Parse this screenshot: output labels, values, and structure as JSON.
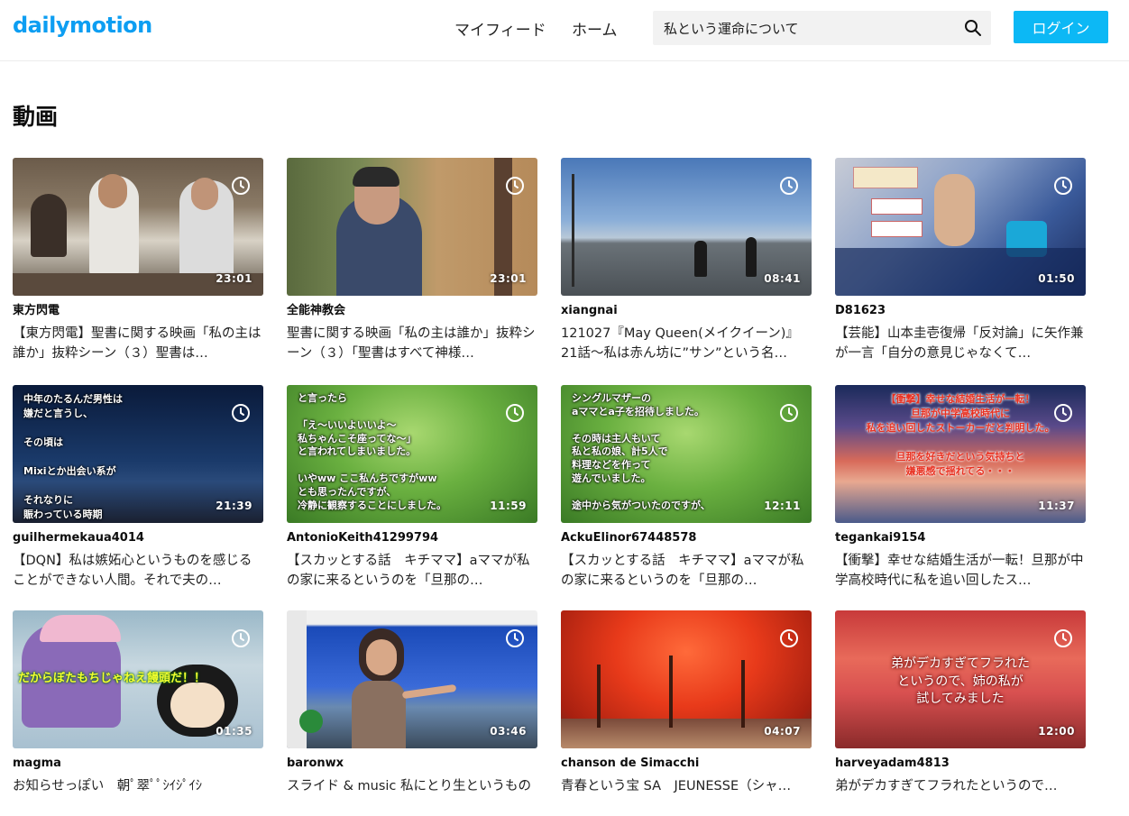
{
  "header": {
    "logo": "dailymotion",
    "nav_feed": "マイフィード",
    "nav_home": "ホーム",
    "search_value": "私という運命について",
    "login_label": "ログイン"
  },
  "section_title": "動画",
  "videos": [
    {
      "channel": "東方閃電",
      "title": "【東方閃電】聖書に関する映画「私の主は誰か」抜粋シーン（３）聖書は…",
      "duration": "23:01",
      "overlay": ""
    },
    {
      "channel": "全能神教会",
      "title": "聖書に関する映画「私の主は誰か」抜粋シーン（３）「聖書はすべて神様…",
      "duration": "23:01",
      "overlay": ""
    },
    {
      "channel": "xiangnai",
      "title": "121027『May Queen(メイクイーン)』21話～私は赤ん坊に”サン”という名…",
      "duration": "08:41",
      "overlay": ""
    },
    {
      "channel": "D81623",
      "title": "【芸能】山本圭壱復帰「反対論」に矢作兼が一言「自分の意見じゃなくて…",
      "duration": "01:50",
      "overlay": ""
    },
    {
      "channel": "guilhermekaua4014",
      "title": "【DQN】私は嫉妬心というものを感じることができない人間。それで夫の…",
      "duration": "21:39",
      "overlay": "中年のたるんだ男性は\n嫌だと言うし、\n\nその頃は\n\nMixiとか出会い系が\n\nそれなりに\n賑わっている時期\n\nだったので、"
    },
    {
      "channel": "AntonioKeith41299794",
      "title": "【スカッとする話　キチママ】aママが私の家に来るというのを「旦那の…",
      "duration": "11:59",
      "overlay": "と言ったら\n\n「え～いいよいいよ～\n私ちゃんこそ座ってな～」\nと言われてしまいました。\n\nいやww ここ私んちですがww\nとも思ったんですが、\n冷静に観察することにしました。"
    },
    {
      "channel": "AckuElinor67448578",
      "title": "【スカッとする話　キチママ】aママが私の家に来るというのを「旦那の…",
      "duration": "12:11",
      "overlay": "シングルマザーの\naママとa子を招待しました。\n\nその時は主人もいて\n私と私の娘、計5人で\n料理などを作って\n遊んでいました。\n\n途中から気がついたのですが、"
    },
    {
      "channel": "tegankai9154",
      "title": "【衝撃】幸せな結婚生活が一転！旦那が中学高校時代に私を追い回したス…",
      "duration": "11:37",
      "overlay": "【衝撃】幸せな結婚生活が一転！\n旦那が中学高校時代に\n私を追い回したストーカーだと判明した。\n\n旦那を好きだという気持ちと\n嫌悪感で揺れてる・・・"
    },
    {
      "channel": "magma",
      "title": "お知らせっぽい　朝ﾟ翠ﾟﾟｼｲｼﾟｲｼ",
      "duration": "01:35",
      "overlay": "だからぼたもちじゃねえ饅頭だ！！"
    },
    {
      "channel": "baronwx",
      "title": "スライド & music 私にとり生というもの",
      "duration": "03:46",
      "overlay": ""
    },
    {
      "channel": "chanson de Simacchi",
      "title": "青春という宝 SA　JEUNESSE（シャ…",
      "duration": "04:07",
      "overlay": ""
    },
    {
      "channel": "harveyadam4813",
      "title": "弟がデカすぎてフラれたというので…",
      "duration": "12:00",
      "overlay": "弟がデカすぎてフラれた\nというので、姉の私が\n試してみました"
    }
  ],
  "colors": {
    "brand": "#0d9ef2",
    "login_bg": "#0cb8f5"
  }
}
